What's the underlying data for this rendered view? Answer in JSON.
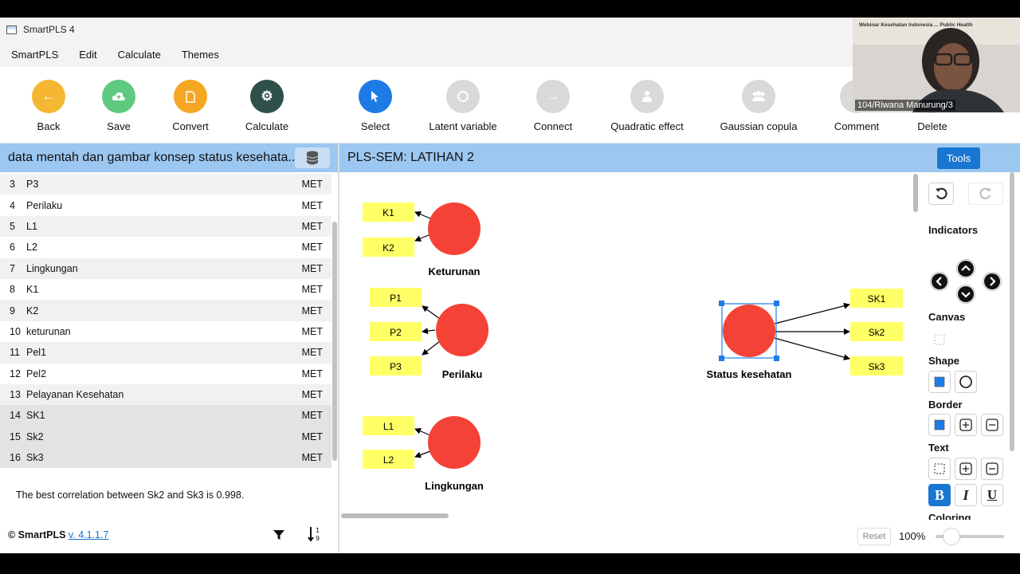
{
  "window": {
    "title": "SmartPLS 4"
  },
  "menu": [
    "SmartPLS",
    "Edit",
    "Calculate",
    "Themes"
  ],
  "toolbar": [
    {
      "label": "Back",
      "icon": "arrow-left-icon",
      "color": "#f5b731"
    },
    {
      "label": "Save",
      "icon": "cloud-upload-icon",
      "color": "#5fc97f"
    },
    {
      "label": "Convert",
      "icon": "document-icon",
      "color": "#f5a623"
    },
    {
      "label": "Calculate",
      "icon": "gear-icon",
      "color": "#2f4f4a"
    },
    {
      "label": "Select",
      "icon": "cursor-icon",
      "color": "#1e7be6"
    },
    {
      "label": "Latent variable",
      "icon": "circle-icon",
      "color": "#d9d9d9"
    },
    {
      "label": "Connect",
      "icon": "arrow-right-icon",
      "color": "#d9d9d9"
    },
    {
      "label": "Quadratic effect",
      "icon": "person-icon",
      "color": "#d9d9d9"
    },
    {
      "label": "Gaussian copula",
      "icon": "group-icon",
      "color": "#d9d9d9"
    },
    {
      "label": "Comment",
      "icon": "comment-icon",
      "color": "#d9d9d9"
    },
    {
      "label": "Delete",
      "icon": "trash-icon",
      "color": "#d9d9d9"
    }
  ],
  "left_panel": {
    "title": "data mentah dan gambar konsep status kesehata...",
    "rows": [
      {
        "num": "3",
        "name": "P3",
        "type": "MET"
      },
      {
        "num": "4",
        "name": "Perilaku",
        "type": "MET"
      },
      {
        "num": "5",
        "name": "L1",
        "type": "MET"
      },
      {
        "num": "6",
        "name": "L2",
        "type": "MET"
      },
      {
        "num": "7",
        "name": "Lingkungan",
        "type": "MET"
      },
      {
        "num": "8",
        "name": "K1",
        "type": "MET"
      },
      {
        "num": "9",
        "name": "K2",
        "type": "MET"
      },
      {
        "num": "10",
        "name": "keturunan",
        "type": "MET"
      },
      {
        "num": "11",
        "name": "Pel1",
        "type": "MET"
      },
      {
        "num": "12",
        "name": "Pel2",
        "type": "MET"
      },
      {
        "num": "13",
        "name": "Pelayanan Kesehatan",
        "type": "MET"
      },
      {
        "num": "14",
        "name": "SK1",
        "type": "MET"
      },
      {
        "num": "15",
        "name": "Sk2",
        "type": "MET"
      },
      {
        "num": "16",
        "name": "Sk3",
        "type": "MET"
      }
    ],
    "status": "The best correlation between Sk2 and Sk3 is 0.998.",
    "footer_brand": "© SmartPLS",
    "footer_version": "v. 4.1.1.7"
  },
  "model": {
    "title": "PLS-SEM: LATIHAN 2",
    "tools_label": "Tools",
    "latents": [
      {
        "name": "Keturunan",
        "indicators": [
          "K1",
          "K2"
        ]
      },
      {
        "name": "Perilaku",
        "indicators": [
          "P1",
          "P2",
          "P3"
        ]
      },
      {
        "name": "Lingkungan",
        "indicators": [
          "L1",
          "L2"
        ]
      },
      {
        "name": "Status kesehatan",
        "indicators": [
          "SK1",
          "Sk2",
          "Sk3"
        ]
      }
    ],
    "colors": {
      "latent": "#f44336",
      "indicator": "#ffff66",
      "selection": "#1e7be6"
    }
  },
  "side_panel": {
    "indicators": "Indicators",
    "canvas": "Canvas",
    "shape": "Shape",
    "border": "Border",
    "text": "Text",
    "coloring": "Coloring"
  },
  "zoom": {
    "reset": "Reset",
    "level": "100%"
  },
  "webcam": {
    "name": "104/Riwana Manurung/3",
    "banner": "Webinar Kesehatan Indonesia ... Public Health"
  }
}
